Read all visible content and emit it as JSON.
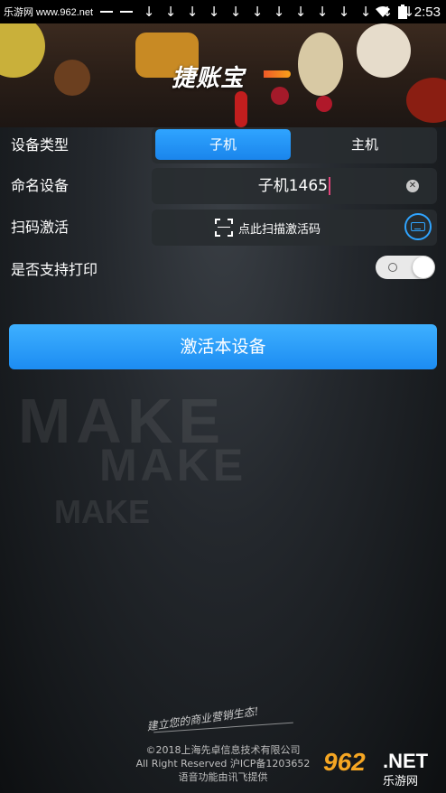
{
  "status_bar": {
    "site_label": "乐游网 www.962.net",
    "download_icons": [
      "↓",
      "↓",
      "↓",
      "↓",
      "↓",
      "↓",
      "↓",
      "↓",
      "↓",
      "↓",
      "↓",
      "↓",
      "↓"
    ],
    "time": "2:53"
  },
  "header": {
    "logo_text": "捷账宝"
  },
  "form": {
    "device_type": {
      "label": "设备类型",
      "options": [
        "子机",
        "主机"
      ],
      "selected": "子机"
    },
    "device_name": {
      "label": "命名设备",
      "value": "子机1465"
    },
    "scan_activate": {
      "label": "扫码激活",
      "button_text": "点此扫描激活码"
    },
    "print_support": {
      "label": "是否支持打印",
      "enabled": false
    },
    "activate_button": "激活本设备"
  },
  "watermark": {
    "line1": "MAKE",
    "line2": "MAKE",
    "line3": "MAKE"
  },
  "slogan": "建立您的商业营销生态!",
  "footer": {
    "copyright": "©2018上海先卓信息技术有限公司",
    "rights": "All Right Reserved 沪ICP备1203652",
    "voice": "语音功能由讯飞提供"
  },
  "brand": {
    "number": "962",
    "net": ".NET",
    "cn": "乐游网"
  },
  "colors": {
    "accent": "#1a8cf2",
    "cursor": "#e0457b"
  }
}
